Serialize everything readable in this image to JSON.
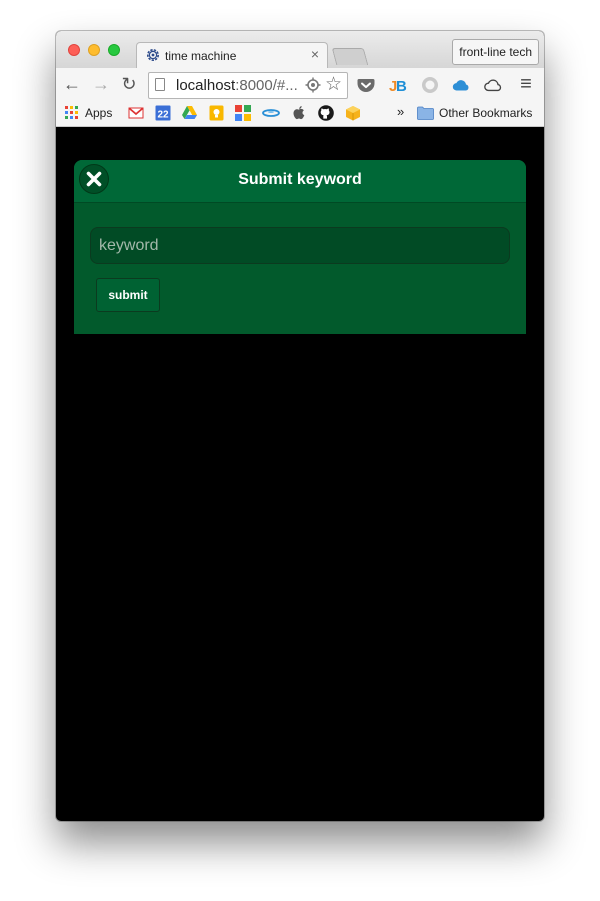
{
  "browser": {
    "tab_title": "time machine",
    "tab_close": "×",
    "profile_button": "front-line tech",
    "url_host": "localhost",
    "url_path": ":8000/#...",
    "back": "←",
    "forward": "→",
    "reload": "↻",
    "star": "☆",
    "menu": "≡",
    "extensions": [
      "pocket-icon",
      "jetbrains-icon",
      "circle-extension-icon",
      "cloud-filled-icon",
      "cloud-outline-icon"
    ]
  },
  "bookmarks": {
    "apps_label": "Apps",
    "calendar_day": "22",
    "overflow": "»",
    "other_label": "Other Bookmarks",
    "icons": [
      "gmail-icon",
      "calendar-icon",
      "drive-icon",
      "keep-icon",
      "apps-grid-icon",
      "disc-icon",
      "apple-icon",
      "github-icon",
      "box-icon"
    ]
  },
  "dialog": {
    "title": "Submit keyword",
    "close_icon": "✖",
    "input_placeholder": "keyword",
    "input_value": "",
    "submit_label": "submit"
  },
  "colors": {
    "dialog_header": "#006837",
    "dialog_body": "#025a2c",
    "page_background": "#000000"
  }
}
